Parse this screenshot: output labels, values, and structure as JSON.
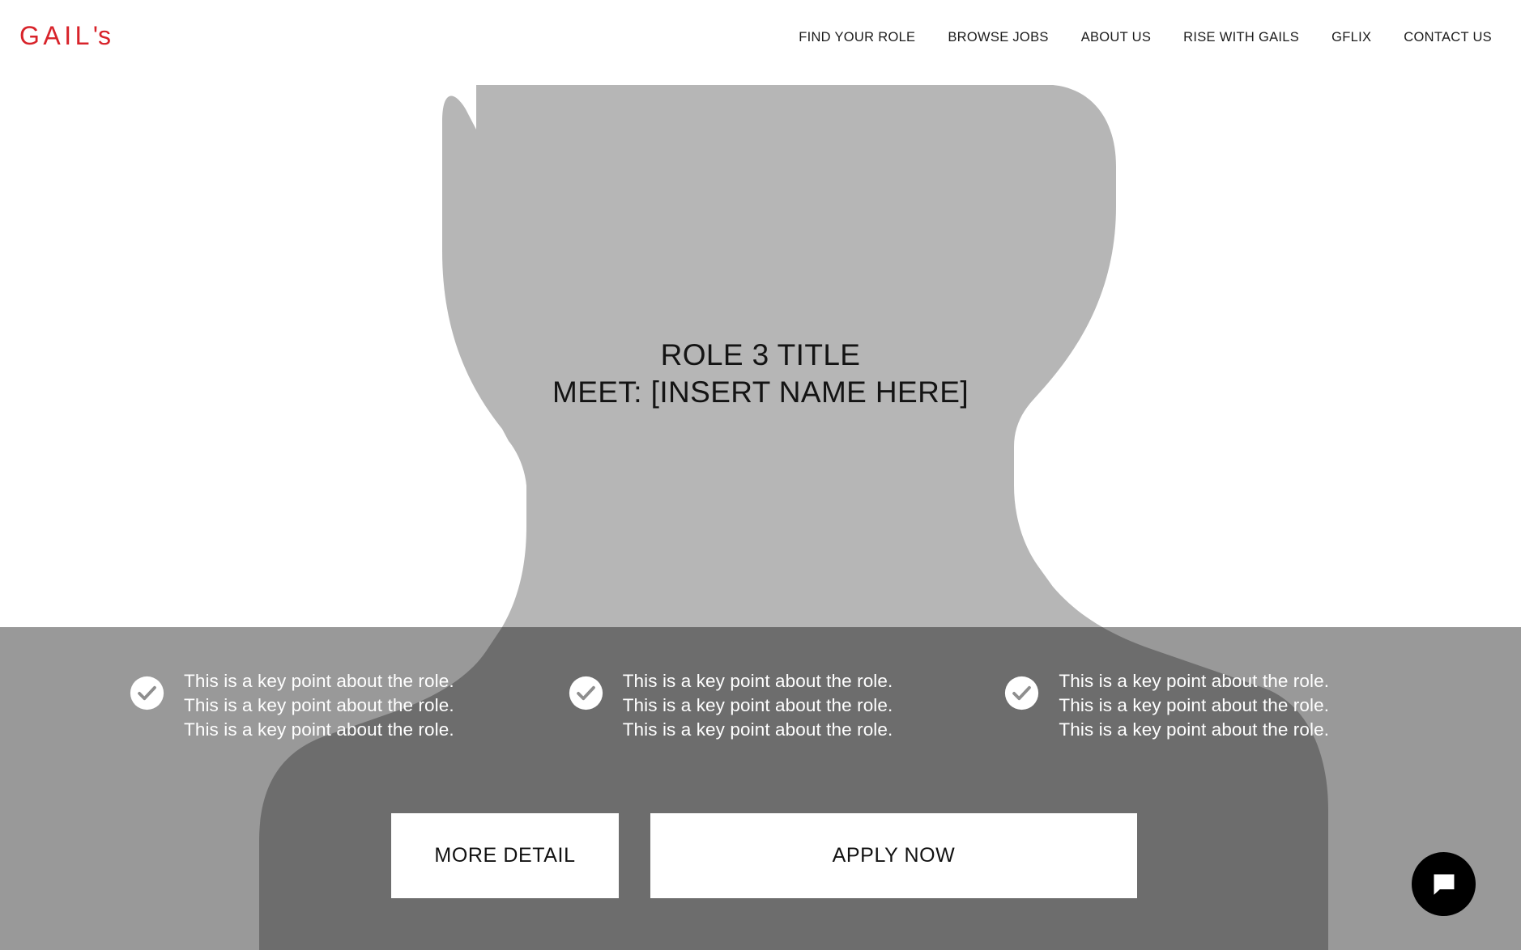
{
  "brand": {
    "logo_text": "GAIL",
    "logo_suffix": "'s",
    "logo_color": "#d8232a"
  },
  "nav": {
    "items": [
      {
        "label": "FIND YOUR ROLE",
        "name": "nav-find-your-role"
      },
      {
        "label": "BROWSE JOBS",
        "name": "nav-browse-jobs"
      },
      {
        "label": "ABOUT US",
        "name": "nav-about-us"
      },
      {
        "label": "RISE WITH GAILS",
        "name": "nav-rise-with-gails"
      },
      {
        "label": "GFLIX",
        "name": "nav-gflix"
      },
      {
        "label": "CONTACT US",
        "name": "nav-contact-us"
      }
    ]
  },
  "hero": {
    "title": "ROLE 3 TITLE",
    "subtitle": "MEET: [INSERT NAME HERE]",
    "silhouette_color": "#b6b6b6",
    "background_color": "#ffffff",
    "overlay_color": "rgba(0,0,0,0.40)"
  },
  "keypoints": {
    "columns": [
      {
        "icon": "check-circle-icon",
        "lines": [
          "This is a key point about the role.",
          "This is a key point about the role.",
          "This is a key point about the role."
        ]
      },
      {
        "icon": "check-circle-icon",
        "lines": [
          "This is a key point about the role.",
          "This is a key point about the role.",
          "This is a key point about the role."
        ]
      },
      {
        "icon": "check-circle-icon",
        "lines": [
          "This is a key point about the role.",
          "This is a key point about the role.",
          "This is a key point about the role."
        ]
      }
    ]
  },
  "cta": {
    "more_detail_label": "MORE DETAIL",
    "apply_now_label": "APPLY NOW"
  },
  "chat": {
    "icon": "chat-bubble-icon",
    "background_color": "#000000"
  }
}
